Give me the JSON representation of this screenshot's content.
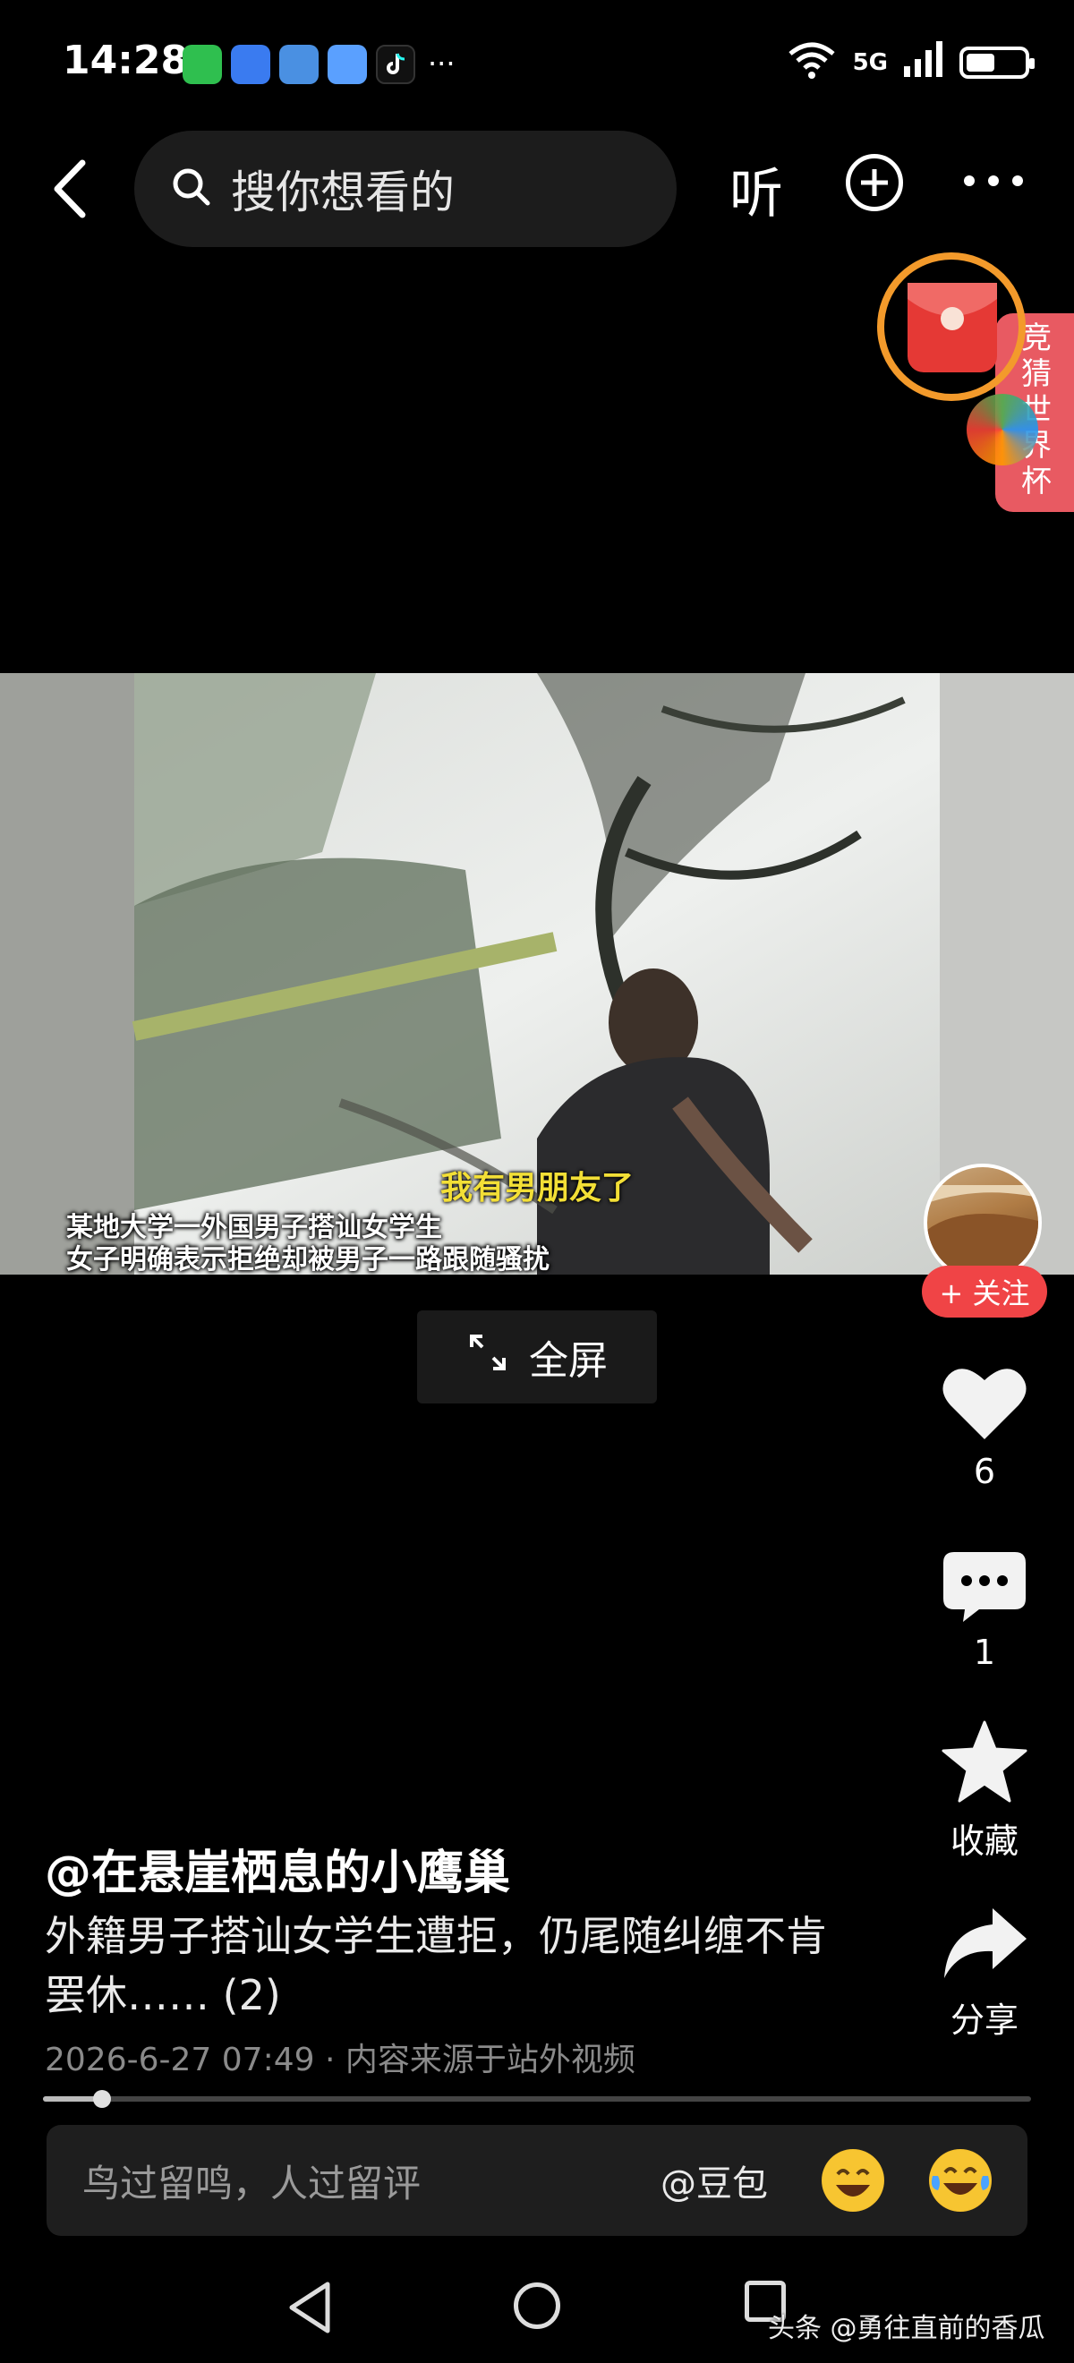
{
  "status_bar": {
    "time": "14:28",
    "more_dots": "···",
    "signal_1": "6",
    "signal_2": "5G",
    "battery_percent": 50
  },
  "top_nav": {
    "search_placeholder": "搜你想看的",
    "listen_label": "听"
  },
  "promo": {
    "text": "竞猜世界杯",
    "ring_color": "#f39a2b",
    "packet_color": "#e53935"
  },
  "video": {
    "subtitle_main": "我有男朋友了",
    "caption_line1": "某地大学一外国男子搭讪女学生",
    "caption_line2": "女子明确表示拒绝却被男子一路跟随骚扰",
    "fullscreen_label": "全屏"
  },
  "rail": {
    "follow_label": "+ 关注",
    "like_count": "6",
    "comment_count": "1",
    "favorite_label": "收藏",
    "share_label": "分享"
  },
  "post": {
    "author": "@在悬崖栖息的小鹰巢",
    "description": "外籍男子搭讪女学生遭拒，仍尾随纠缠不肯罢休…… (2)",
    "meta": "2026-6-27 07:49 · 内容来源于站外视频",
    "progress_fraction": 0.06
  },
  "comment_bar": {
    "placeholder": "鸟过留鸣，人过留评",
    "at_label": "@豆包"
  },
  "watermark": "头条 @勇往直前的香瓜"
}
